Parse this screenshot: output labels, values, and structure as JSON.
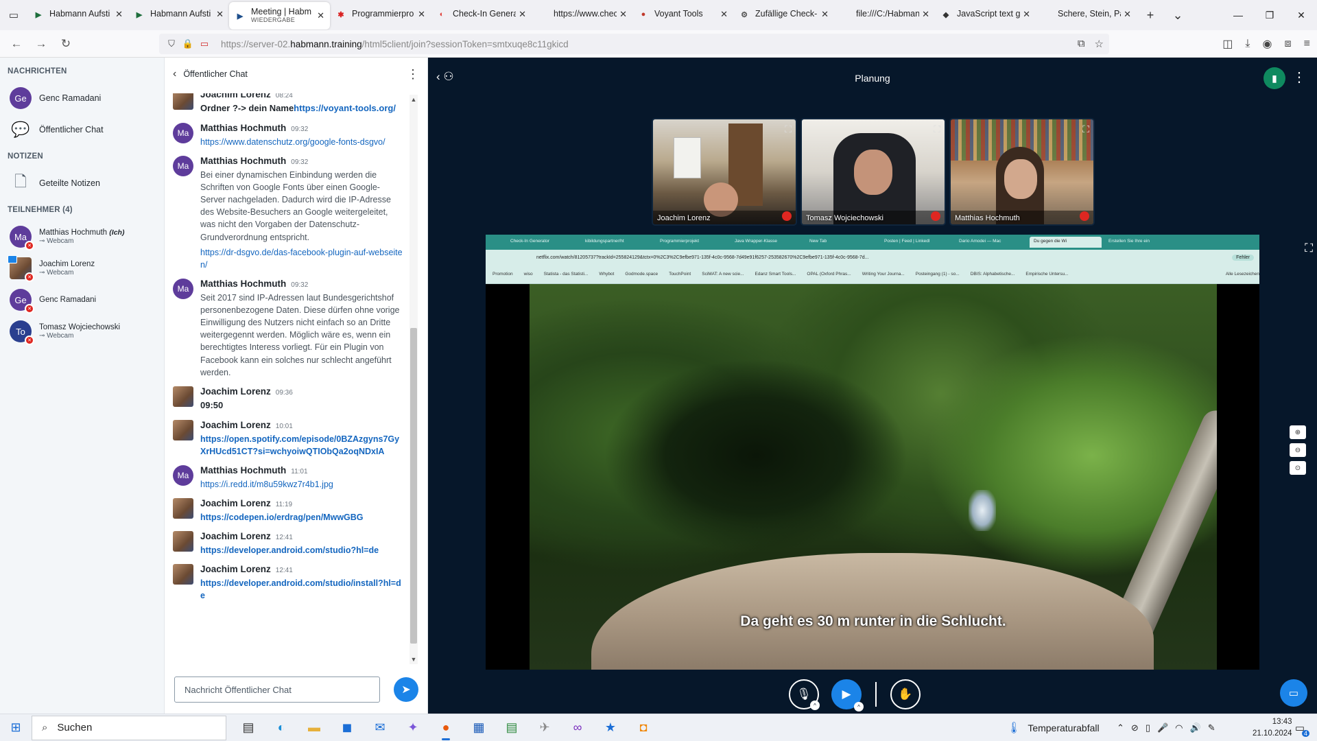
{
  "browser": {
    "tabs": [
      {
        "title": "Habmann Aufsti",
        "icon": "▶",
        "color": "#1e6e3c"
      },
      {
        "title": "Habmann Aufsti",
        "icon": "▶",
        "color": "#1e6e3c"
      },
      {
        "title": "Meeting | Habm",
        "subtitle": "WIEDERGABE",
        "icon": "▶",
        "color": "#1e4f8c",
        "active": true
      },
      {
        "title": "Programmierpro",
        "icon": "✱",
        "color": "#d92020"
      },
      {
        "title": "Check-In Genera",
        "icon": "◐",
        "color": "#e0413b"
      },
      {
        "title": "https://www.checkin",
        "icon": "",
        "color": "#444"
      },
      {
        "title": "Voyant Tools",
        "icon": "●",
        "color": "#c0392b"
      },
      {
        "title": "Zufällige Check-",
        "icon": "⚙",
        "color": "#555"
      },
      {
        "title": "file:///C:/Habmann/",
        "icon": "",
        "color": "#444"
      },
      {
        "title": "JavaScript text g",
        "icon": "◆",
        "color": "#333"
      },
      {
        "title": "Schere, Stein, Papier",
        "icon": "",
        "color": "#444"
      }
    ],
    "url_prefix": "https://server-02.",
    "url_host": "habmann.training",
    "url_suffix": "/html5client/join?sessionToken=smtxuqe8c11gkicd"
  },
  "sidebar": {
    "messages_title": "NACHRICHTEN",
    "messages": [
      {
        "initials": "Ge",
        "name": "Genc Ramadani",
        "color": "#5e3c9b"
      },
      {
        "name": "Öffentlicher Chat"
      }
    ],
    "notes_title": "NOTIZEN",
    "notes_item": "Geteilte Notizen",
    "participants_title": "TEILNEHMER (4)",
    "participants": [
      {
        "initials": "Ma",
        "name": "Matthias Hochmuth",
        "me": "(Ich)",
        "sub": "Webcam",
        "color": "#5e3c9b"
      },
      {
        "initials": "",
        "name": "Joachim Lorenz",
        "me": "",
        "sub": "Webcam",
        "color": "#7c5a3e"
      },
      {
        "initials": "Ge",
        "name": "Genc Ramadani",
        "me": "",
        "sub": "",
        "color": "#5e3c9b"
      },
      {
        "initials": "To",
        "name": "Tomasz Wojciechowski",
        "me": "",
        "sub": "Webcam",
        "color": "#2a3f8f"
      }
    ]
  },
  "chat": {
    "title": "Öffentlicher Chat",
    "placeholder": "Nachricht Öffentlicher Chat",
    "messages": [
      {
        "author": "Joachim Lorenz",
        "time": "08:24",
        "text": "Ordner ?-> dein Name",
        "link": "https://voyant-tools.org/",
        "bold": true
      },
      {
        "author": "Matthias Hochmuth",
        "time": "09:32",
        "text": "",
        "link": "https://www.datenschutz.org/google-fonts-dsgvo/",
        "bold": false
      },
      {
        "author": "Matthias Hochmuth",
        "time": "09:32",
        "text": "Bei einer dynamischen Einbindung werden die Schriften von Google Fonts über einen Google-Server nachgeladen. Dadurch wird die IP-Adresse des Website-Besuchers an Google weitergeleitet, was nicht den Vorgaben der Datenschutz-Grundverordnung entspricht.",
        "link": "https://dr-dsgvo.de/das-facebook-plugin-auf-webseiten/",
        "bold": false
      },
      {
        "author": "Matthias Hochmuth",
        "time": "09:32",
        "text": "Seit 2017 sind IP-Adressen laut Bundesgerichtshof personenbezogene Daten. Diese dürfen ohne vorige Einwilligung des Nutzers nicht einfach so an Dritte weitergegennt werden. Möglich wäre es, wenn ein berechtigtes Interess vorliegt. Für ein Plugin von Facebook kann ein solches nur schlecht angeführt werden.",
        "link": "",
        "bold": false
      },
      {
        "author": "Joachim Lorenz",
        "time": "09:36",
        "text": "09:50",
        "link": "",
        "bold": true
      },
      {
        "author": "Joachim Lorenz",
        "time": "10:01",
        "text": "",
        "link": "https://open.spotify.com/episode/0BZAzgyns7GyXrHUcd51CT?si=wchyoiwQTIObQa2oqNDxIA",
        "bold": true
      },
      {
        "author": "Matthias Hochmuth",
        "time": "11:01",
        "text": "",
        "link": "https://i.redd.it/m8u59kwz7r4b1.jpg",
        "bold": false
      },
      {
        "author": "Joachim Lorenz",
        "time": "11:19",
        "text": "",
        "link": "https://codepen.io/erdrag/pen/MwwGBG",
        "bold": true
      },
      {
        "author": "Joachim Lorenz",
        "time": "12:41",
        "text": "",
        "link": "https://developer.android.com/studio?hl=de",
        "bold": true
      },
      {
        "author": "Joachim Lorenz",
        "time": "12:41",
        "text": "",
        "link": "https://developer.android.com/studio/install?hl=de",
        "bold": true
      }
    ]
  },
  "meeting": {
    "title": "Planung",
    "cams": [
      {
        "name": "Joachim Lorenz"
      },
      {
        "name": "Tomasz Wojciechowski"
      },
      {
        "name": "Matthias Hochmuth"
      }
    ],
    "subtitle": "Da geht es 30 m runter in die Schlucht.",
    "inner_tabs": [
      "Check-In Generator",
      "kibildungspartner/ht",
      "Programmierprojekt",
      "Java Wrapper-Klasse",
      "New Tab",
      "Posten | Feed | Linkedl",
      "Dario Amodei — Mac",
      "Du gegen die Wi",
      "Erstellen Sie Ihre ein"
    ],
    "inner_url": "netflix.com/watch/81205737?trackId=255824129&tctx=0%2C3%2C9efbe971-135f-4c0c-9568-7d49e91f6257-253582670%2C9efbe971-135f-4c0c-9568-7d...",
    "inner_bookmarks": [
      "Promotion",
      "wiso",
      "Statista - das Statisti...",
      "Whybot",
      "Godmode.space",
      "TouchPoint",
      "SciMAT: A new scie...",
      "Edanz Smart Tools...",
      "OPAL (Oxford Phras...",
      "Writing Your Journa...",
      "Posteingang (1) - so...",
      "DBIS: Alphabetische...",
      "Empirische Untersu...",
      "Alle Lesezeichen"
    ],
    "inner_error_badge": "Fehler"
  },
  "taskbar": {
    "search": "Suchen",
    "weather": "Temperaturabfall",
    "time": "13:43",
    "date": "21.10.2024",
    "notifications": "4"
  }
}
